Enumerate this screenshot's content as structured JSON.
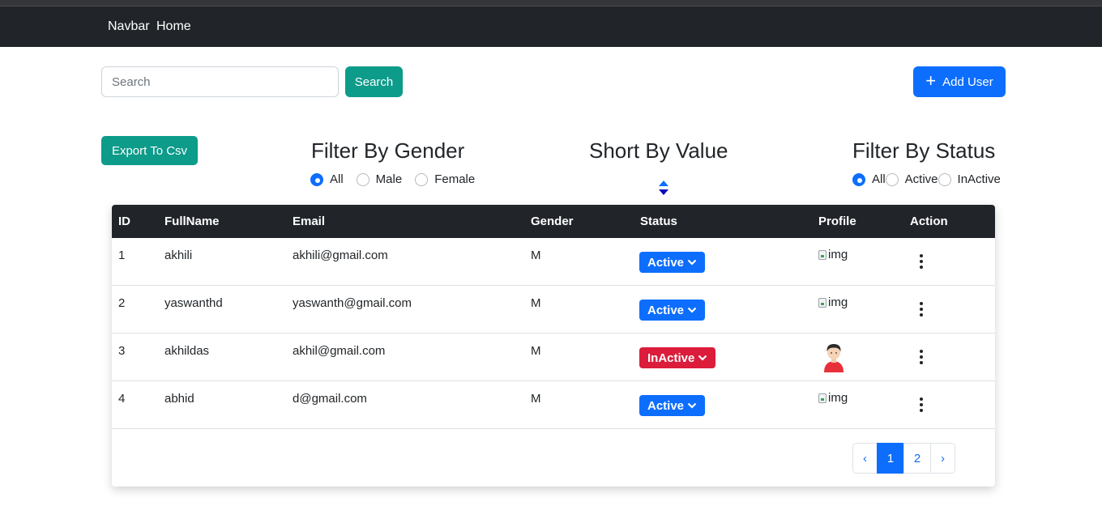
{
  "navbar": {
    "brand": "Navbar",
    "home": "Home"
  },
  "search": {
    "placeholder": "Search",
    "button": "Search"
  },
  "add_user": {
    "label": "Add User",
    "icon": "plus-icon"
  },
  "export": {
    "label": "Export To Csv"
  },
  "filters": {
    "gender": {
      "title": "Filter By Gender",
      "options": [
        "All",
        "Male",
        "Female"
      ],
      "selected": "All"
    },
    "sort": {
      "title": "Short By Value",
      "icon": "sort-updown-icon"
    },
    "status": {
      "title": "Filter By Status",
      "options": [
        "All",
        "Active",
        "InActive"
      ],
      "selected": "All"
    }
  },
  "table": {
    "headers": [
      "ID",
      "FullName",
      "Email",
      "Gender",
      "Status",
      "Profile",
      "Action"
    ],
    "rows": [
      {
        "id": "1",
        "fullname": "akhili",
        "email": "akhili@gmail.com",
        "gender": "M",
        "status": "Active",
        "profile": "img"
      },
      {
        "id": "2",
        "fullname": "yaswanthd",
        "email": "yaswanth@gmail.com",
        "gender": "M",
        "status": "Active",
        "profile": "img"
      },
      {
        "id": "3",
        "fullname": "akhildas",
        "email": "akhil@gmail.com",
        "gender": "M",
        "status": "InActive",
        "profile": "avatar"
      },
      {
        "id": "4",
        "fullname": "abhid",
        "email": "d@gmail.com",
        "gender": "M",
        "status": "Active",
        "profile": "img"
      }
    ]
  },
  "pagination": {
    "prev": "‹",
    "pages": [
      "1",
      "2"
    ],
    "current": "1",
    "next": "›"
  },
  "colors": {
    "navbar": "#212529",
    "primary": "#0d6efd",
    "teal": "#0d9b8a",
    "danger": "#dc1c3b"
  }
}
